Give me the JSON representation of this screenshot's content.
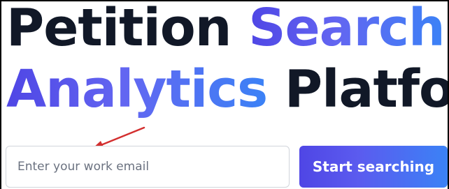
{
  "hero": {
    "line1_prefix": "Petition ",
    "line1_accent": "Search",
    "line1_suffix": " &",
    "line2_accent": "Analytics",
    "line2_suffix": " Platform"
  },
  "signup": {
    "email_placeholder": "Enter your work email",
    "email_value": "",
    "cta_label": "Start searching"
  },
  "annotation": {
    "icon": "red-arrow-icon",
    "color": "#d32f2f"
  },
  "colors": {
    "heading_text": "#111827",
    "accent_start": "#4f46e5",
    "accent_end": "#3b82f6"
  }
}
